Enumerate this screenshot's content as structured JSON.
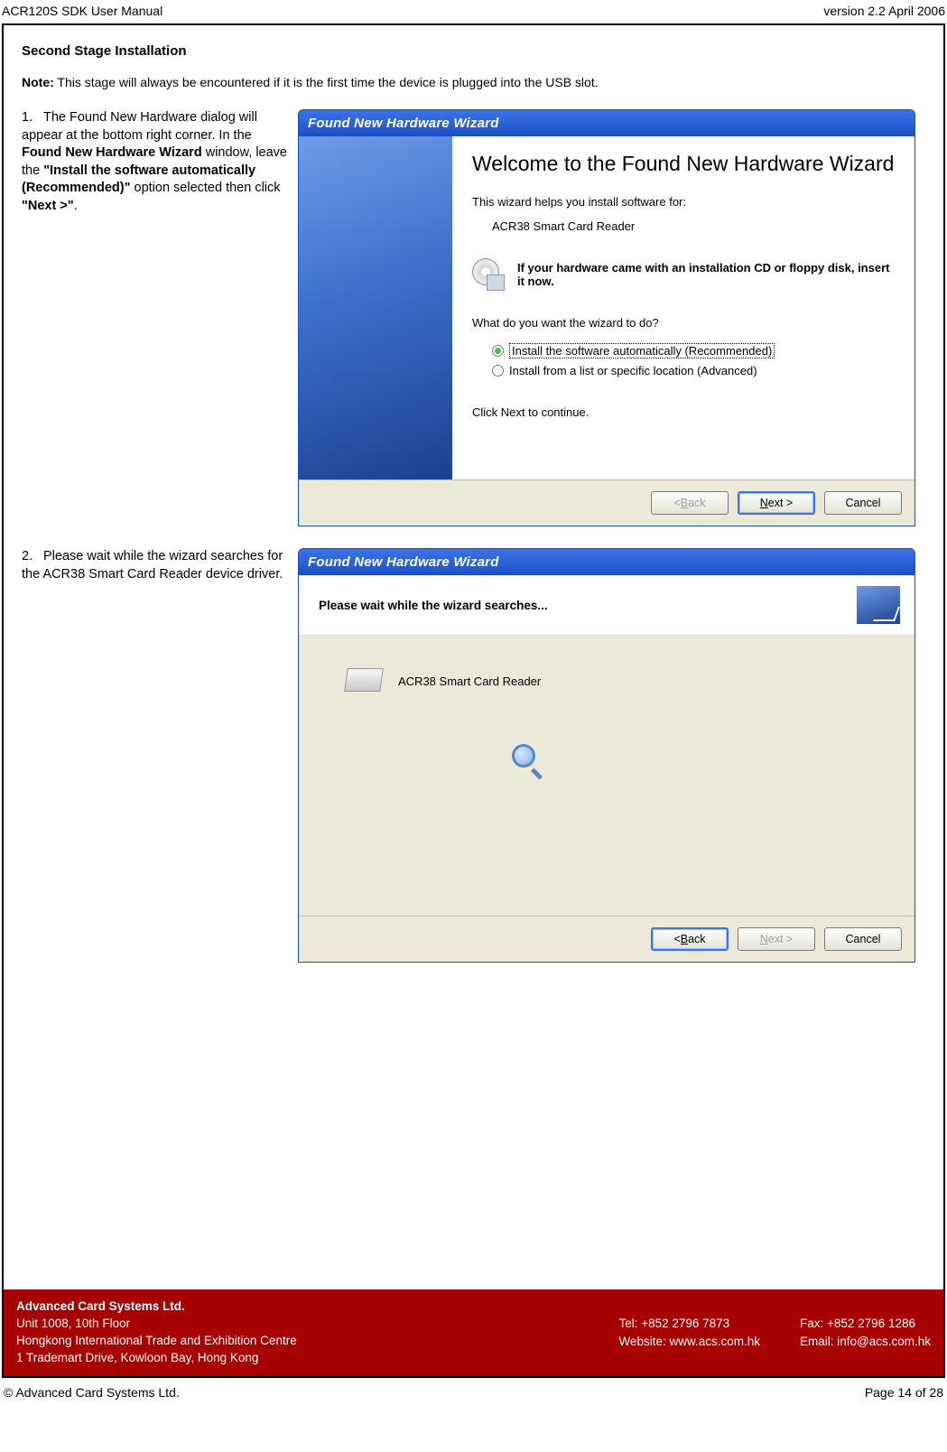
{
  "header": {
    "left": "ACR120S SDK User Manual",
    "right": "version 2.2 April 2006"
  },
  "section_title": "Second Stage Installation",
  "note": {
    "label": "Note:",
    "text": " This stage will always be encountered if it is the first time the device is plugged into the USB slot."
  },
  "step1": {
    "num": "1.",
    "t1": "The Found New Hardware dialog will appear at the bottom right corner. In the ",
    "b1": "Found New Hardware Wizard",
    "t2": " window, leave the ",
    "b2": "\"Install the software automatically (Recommended)\"",
    "t3": " option selected then click ",
    "b3": "\"Next >\"",
    "t4": "."
  },
  "step2": {
    "num": "2.",
    "text": "Please wait while the wizard searches for the ACR38 Smart Card Reader device driver."
  },
  "wiz1": {
    "title": "Found New Hardware Wizard",
    "heading": "Welcome to the Found New Hardware Wizard",
    "p1": "This wizard helps you install software for:",
    "device": "ACR38 Smart Card Reader",
    "cd_text": "If your hardware came with an installation CD or floppy disk, insert it now.",
    "q": "What do you want the wizard to do?",
    "opt1": "Install the software automatically (Recommended)",
    "opt2": "Install from a list or specific location (Advanced)",
    "cont": "Click Next to continue."
  },
  "wiz2": {
    "title": "Found New Hardware Wizard",
    "heading": "Please wait while the wizard searches...",
    "device": "ACR38 Smart Card Reader"
  },
  "buttons": {
    "back_pre": "< ",
    "back_u": "B",
    "back_post": "ack",
    "next_u": "N",
    "next_post": "ext >",
    "cancel": "Cancel"
  },
  "footer": {
    "company": "Advanced Card Systems Ltd.",
    "addr1": "Unit 1008, 10th Floor",
    "addr2": "Hongkong International Trade and Exhibition Centre",
    "addr3": "1 Trademart Drive, Kowloon Bay, Hong Kong",
    "tel": "Tel: +852 2796 7873",
    "web": "Website: www.acs.com.hk",
    "fax": "Fax: +852 2796 1286",
    "email": "Email: info@acs.com.hk"
  },
  "bottom": {
    "left": "© Advanced Card Systems Ltd.",
    "right": "Page 14 of 28"
  }
}
